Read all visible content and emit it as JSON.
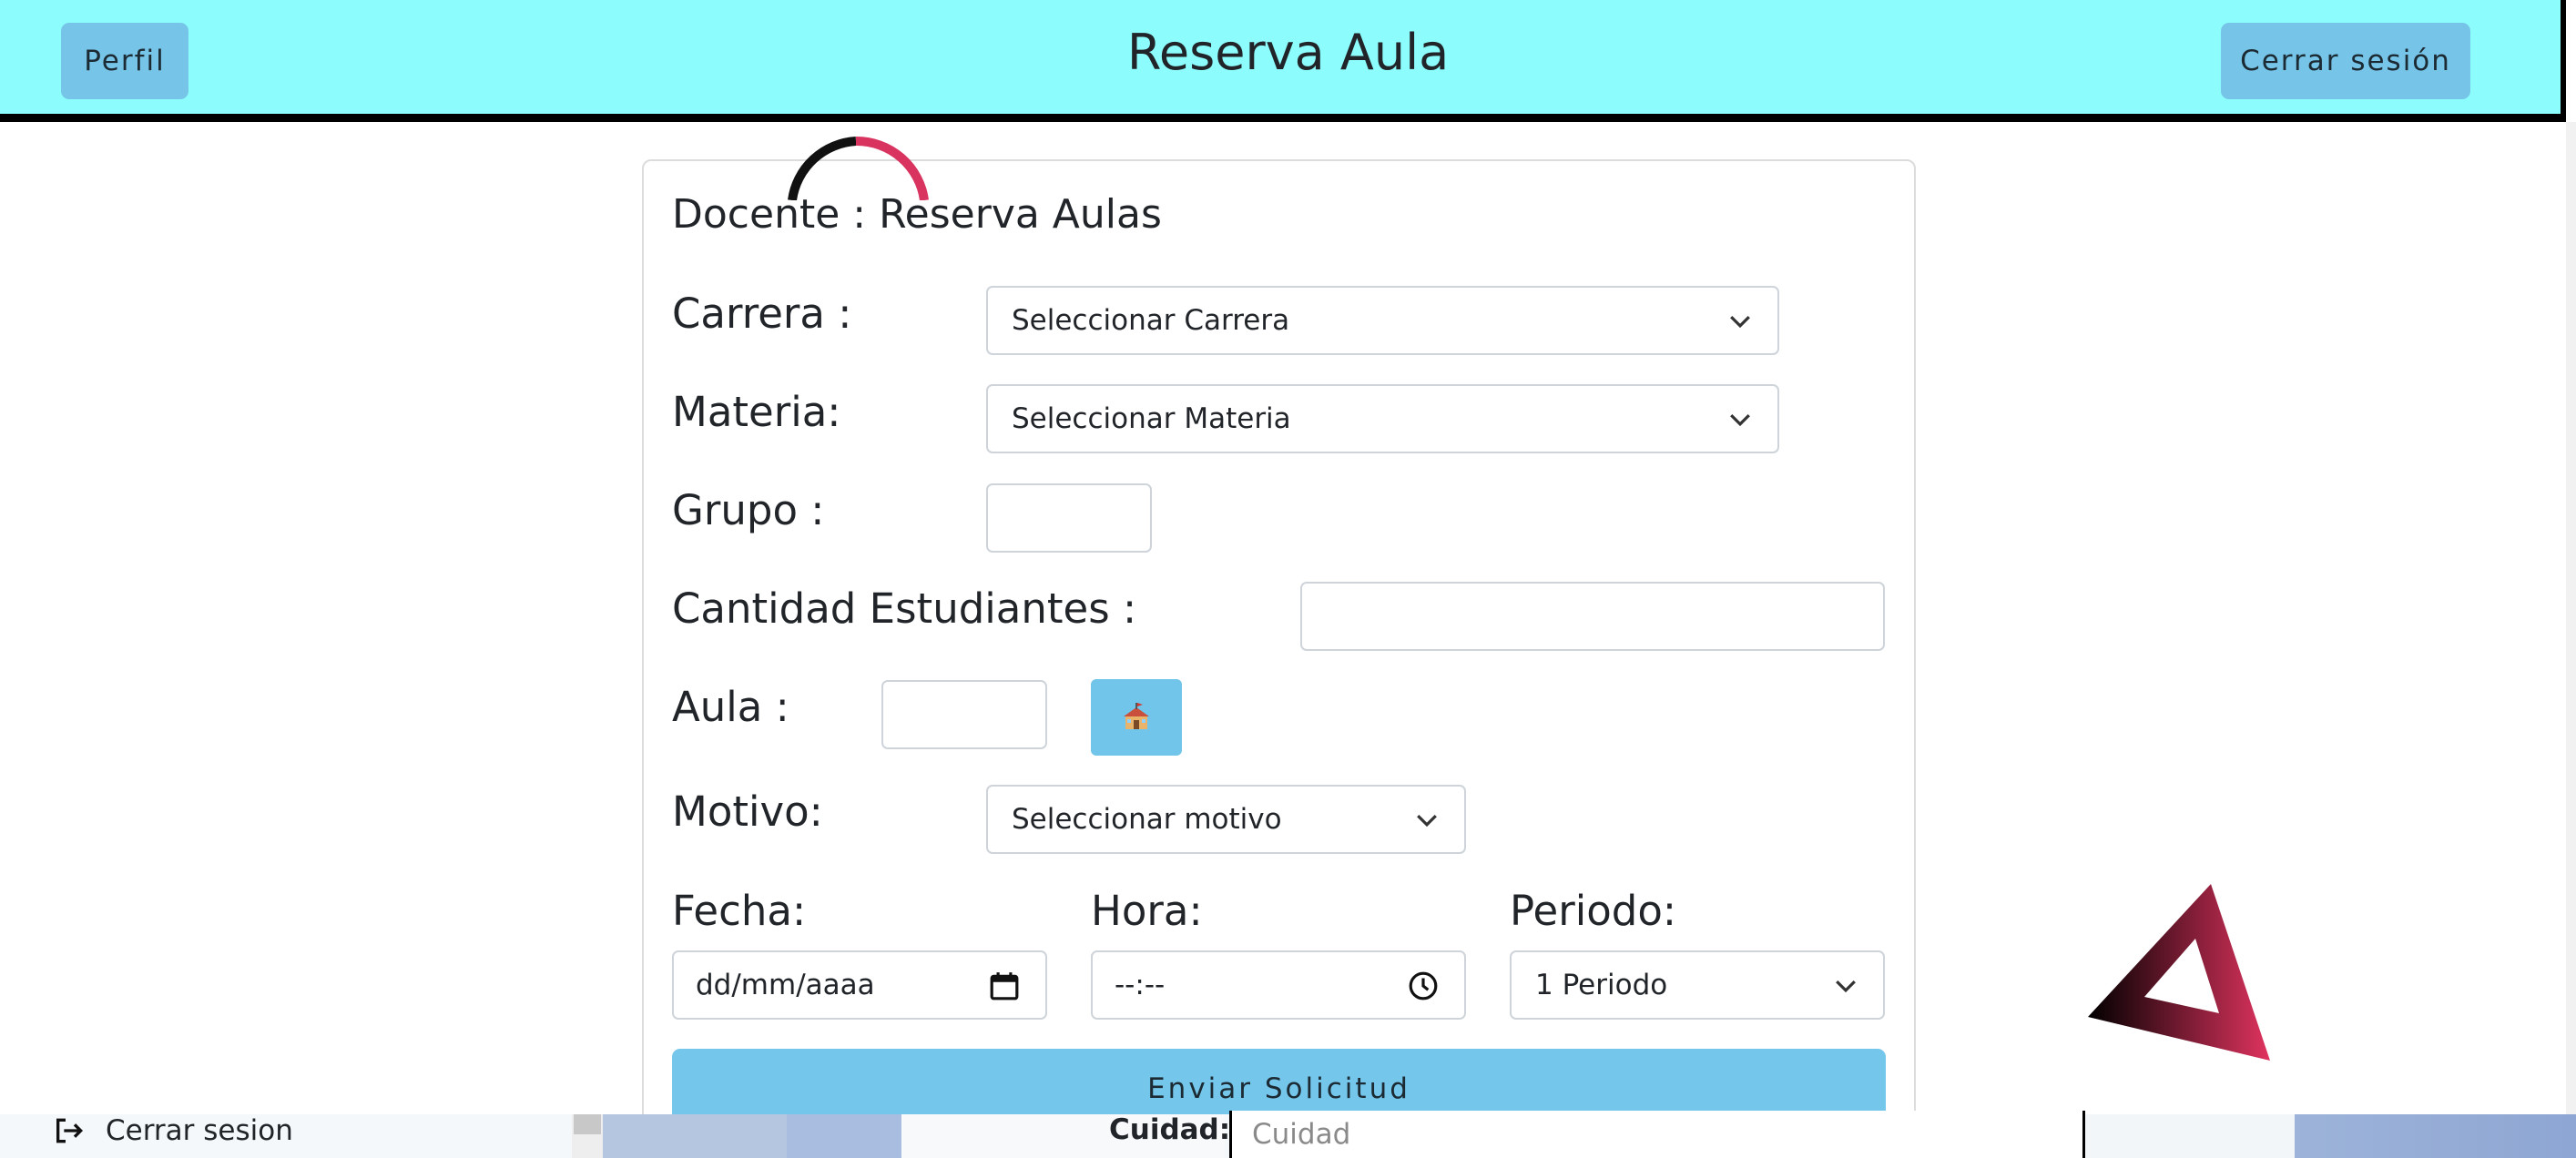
{
  "header": {
    "title": "Reserva Aula",
    "profile_label": "Perfil",
    "logout_label": "Cerrar sesión",
    "bg_color": "#8cfcfc",
    "button_color": "#76c5e8"
  },
  "form": {
    "title": "Docente : Reserva Aulas",
    "carrera": {
      "label": "Carrera :",
      "value": "Seleccionar Carrera"
    },
    "materia": {
      "label": "Materia:",
      "value": "Seleccionar Materia"
    },
    "grupo": {
      "label": "Grupo :",
      "value": ""
    },
    "cantidad": {
      "label": "Cantidad Estudiantes :",
      "value": ""
    },
    "aula": {
      "label": "Aula :",
      "value": "",
      "button_icon": "school-building-icon"
    },
    "motivo": {
      "label": "Motivo:",
      "value": "Seleccionar motivo"
    },
    "fecha": {
      "label": "Fecha:",
      "placeholder": "dd/mm/aaaa",
      "icon": "calendar-icon"
    },
    "hora": {
      "label": "Hora:",
      "placeholder": "--:--",
      "icon": "clock-icon"
    },
    "periodo": {
      "label": "Periodo:",
      "value": "1 Periodo"
    },
    "submit_label": "Enviar Solicitud",
    "submit_color": "#74c6ea"
  },
  "bottom": {
    "logout_label": "Cerrar sesion",
    "city_label": "Cuidad:",
    "city_placeholder": "Cuidad"
  }
}
